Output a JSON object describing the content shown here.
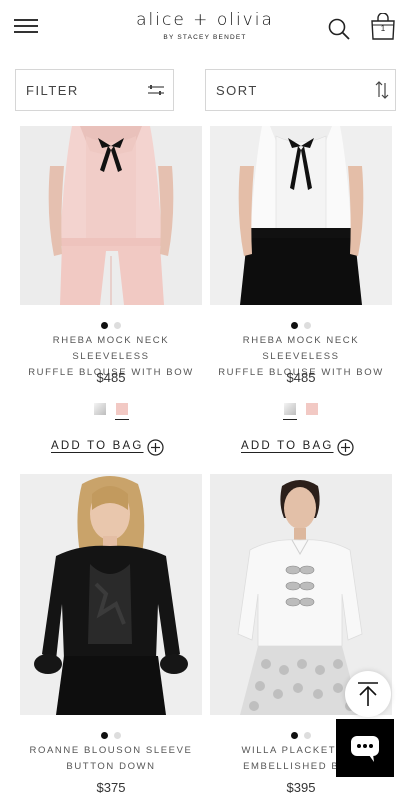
{
  "header": {
    "brand": "alice + olivia",
    "brand_sub": "BY STACEY BENDET",
    "bag_count": "1"
  },
  "toolbar": {
    "filter_label": "FILTER",
    "sort_label": "SORT"
  },
  "products": [
    {
      "name_line1": "RHEBA MOCK NECK SLEEVELESS",
      "name_line2": "RUFFLE BLOUSE WITH BOW",
      "price": "$485",
      "add_label": "ADD TO BAG",
      "swatch_colors": [
        "#d9d9d9",
        "#f2c9c4"
      ],
      "selected_swatch": 1
    },
    {
      "name_line1": "RHEBA MOCK NECK SLEEVELESS",
      "name_line2": "RUFFLE BLOUSE WITH BOW",
      "price": "$485",
      "add_label": "ADD TO BAG",
      "swatch_colors": [
        "#d9d9d9",
        "#f2c9c4"
      ],
      "selected_swatch": 0
    },
    {
      "name_line1": "ROANNE BLOUSON SLEEVE",
      "name_line2": "BUTTON DOWN",
      "price": "$375"
    },
    {
      "name_line1": "WILLA PLACKET TOI",
      "name_line2": "EMBELLISHED BOW",
      "price": "$395"
    }
  ],
  "icons": [
    "hamburger-menu-icon",
    "search-icon",
    "shopping-bag-icon",
    "filter-sliders-icon",
    "sort-arrows-icon",
    "add-circle-icon",
    "scroll-to-top-icon",
    "chat-icon"
  ],
  "colors": {
    "text": "#222222",
    "border": "#d6d6d6",
    "chat_bg": "#000000"
  }
}
